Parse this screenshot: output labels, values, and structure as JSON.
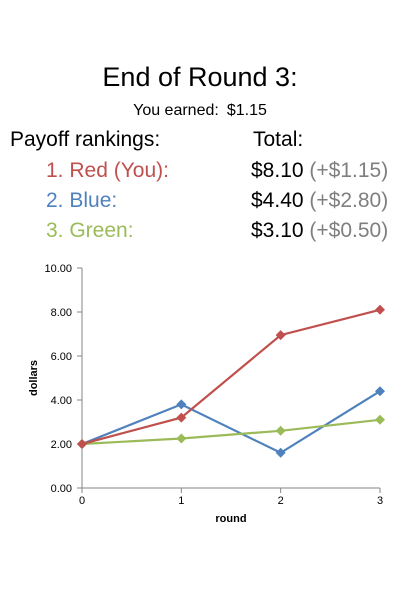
{
  "header": {
    "title": "End of Round 3:",
    "earned_label": "You earned:",
    "earned_value": "$1.15"
  },
  "rankings": {
    "heading": "Payoff rankings:",
    "total_heading": "Total:",
    "rows": [
      {
        "label": "1. Red (You):",
        "total": "$8.10",
        "delta": "(+$1.15)",
        "color": "#c0504d"
      },
      {
        "label": "2. Blue:",
        "total": "$4.40",
        "delta": "(+$2.80)",
        "color": "#4f81bd"
      },
      {
        "label": "3. Green:",
        "total": "$3.10",
        "delta": "(+$0.50)",
        "color": "#9bbb59"
      }
    ]
  },
  "chart_data": {
    "type": "line",
    "x": [
      0,
      1,
      2,
      3
    ],
    "xlabel": "round",
    "ylabel": "dollars",
    "ylim": [
      0,
      10
    ],
    "yticks": [
      "0.00",
      "2.00",
      "4.00",
      "6.00",
      "8.00",
      "10.00"
    ],
    "xticks": [
      "0",
      "1",
      "2",
      "3"
    ],
    "marker": "diamond",
    "grid": false,
    "series": [
      {
        "color": "#4f81bd",
        "values": [
          2.0,
          3.8,
          1.6,
          4.4
        ]
      },
      {
        "color": "#9bbb59",
        "values": [
          2.0,
          2.25,
          2.6,
          3.1
        ]
      },
      {
        "color": "#c0504d",
        "values": [
          2.0,
          3.2,
          6.95,
          8.1
        ]
      }
    ]
  }
}
